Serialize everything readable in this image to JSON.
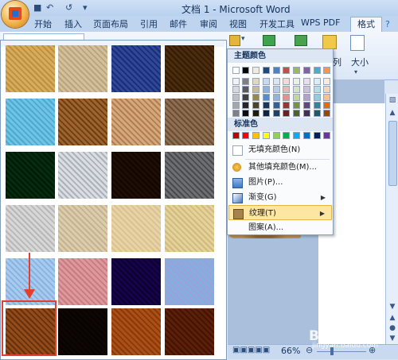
{
  "window": {
    "title": "文档 1 - Microsoft Word"
  },
  "tabs": [
    "开始",
    "插入",
    "页面布局",
    "引用",
    "邮件",
    "审阅",
    "视图",
    "开发工具",
    "WPS PDF",
    "格式"
  ],
  "ribbon": {
    "arrange_label": "列",
    "size_label": "大小"
  },
  "menu": {
    "theme_colors_label": "主题颜色",
    "standard_colors_label": "标准色",
    "items": [
      {
        "label": "无填充颜色(N)",
        "icon": "no-fill-icon"
      },
      {
        "label": "其他填充颜色(M)...",
        "icon": "palette-icon"
      },
      {
        "label": "图片(P)...",
        "icon": "picture-icon"
      },
      {
        "label": "渐变(G)",
        "icon": "gradient-icon",
        "submenu": true
      },
      {
        "label": "纹理(T)",
        "icon": "texture-icon",
        "submenu": true,
        "highlighted": true
      },
      {
        "label": "图案(A)...",
        "icon": "pattern-icon"
      }
    ],
    "theme_top_row": [
      "#ffffff",
      "#000000",
      "#eeece1",
      "#1f497d",
      "#4f81bd",
      "#c0504d",
      "#9bbb59",
      "#8064a2",
      "#4bacc6",
      "#f79646"
    ],
    "theme_shade_columns": [
      [
        "#f2f2f2",
        "#d9d9d9",
        "#bfbfbf",
        "#a6a6a6",
        "#808080"
      ],
      [
        "#7f7f7f",
        "#595959",
        "#404040",
        "#262626",
        "#0d0d0d"
      ],
      [
        "#ddd9c3",
        "#c4bd97",
        "#938953",
        "#494429",
        "#1d1b10"
      ],
      [
        "#c6d9f0",
        "#8db3e2",
        "#548dd4",
        "#17365d",
        "#0f243e"
      ],
      [
        "#dbe5f1",
        "#b8cce4",
        "#95b3d7",
        "#366092",
        "#244061"
      ],
      [
        "#f2dcdb",
        "#e5b9b7",
        "#d99694",
        "#953734",
        "#632423"
      ],
      [
        "#ebf1dd",
        "#d7e3bc",
        "#c3d69b",
        "#76923c",
        "#4f6128"
      ],
      [
        "#e5e0ec",
        "#ccc1d9",
        "#b2a2c7",
        "#5f497a",
        "#3f3151"
      ],
      [
        "#dbeef3",
        "#b7dde8",
        "#92cddc",
        "#31859b",
        "#205867"
      ],
      [
        "#fdeada",
        "#fbd5b5",
        "#fac08f",
        "#e36c09",
        "#974806"
      ]
    ],
    "standard_colors": [
      "#c00000",
      "#ff0000",
      "#ffc000",
      "#ffff00",
      "#92d050",
      "#00b050",
      "#00b0f0",
      "#0070c0",
      "#002060",
      "#7030a0"
    ]
  },
  "textures": {
    "selected_index": 20,
    "names": [
      "papyrus",
      "canvas",
      "denim",
      "woven-mat",
      "water-droplets",
      "paper-bag",
      "fish-fossil",
      "sand",
      "green-marble",
      "white-marble",
      "brown-marble",
      "granite",
      "newsprint",
      "recycled-paper",
      "parchment",
      "stationery",
      "blue-tissue-paper",
      "pink-tissue-paper",
      "purple-mesh",
      "bouquet",
      "cork",
      "walnut",
      "oak",
      "medium-wood"
    ],
    "colors": [
      [
        "#e9d29a",
        "#cfae68"
      ],
      [
        "#e8ddc7",
        "#cbbd9f"
      ],
      [
        "#6f88c4",
        "#3b55a0"
      ],
      [
        "#8a6a3a",
        "#5c4322"
      ],
      [
        "#a9dff0",
        "#6fc3e1"
      ],
      [
        "#c9a06a",
        "#8b6334"
      ],
      [
        "#e8cfb2",
        "#c49a72"
      ],
      [
        "#bfa88e",
        "#8c7662"
      ],
      [
        "#1f6a3a",
        "#0c3c1d"
      ],
      [
        "#eceef0",
        "#b9bec4"
      ],
      [
        "#5a3a22",
        "#2d1a0e"
      ],
      [
        "#a7a9ab",
        "#6e7073"
      ],
      [
        "#eaeaea",
        "#c8c8c8"
      ],
      [
        "#ece4d2",
        "#d5c8ad"
      ],
      [
        "#f3e8cf",
        "#e6d4ad"
      ],
      [
        "#f1e7c7",
        "#dccd9f"
      ],
      [
        "#cfe3f6",
        "#a7c8ea"
      ],
      [
        "#edc6c8",
        "#d99ea4"
      ],
      [
        "#4a1a8a",
        "#2a0a55"
      ],
      [
        "#b7d3ef",
        "#d9c2e8"
      ],
      [
        "#c18a50",
        "#8a5a2a"
      ],
      [
        "#3c2817",
        "#1f140b"
      ],
      [
        "#d08f4a",
        "#a9652a"
      ],
      [
        "#9a5a2a",
        "#6a3612"
      ]
    ]
  },
  "status": {
    "zoom": "66%"
  },
  "watermark": {
    "text": "Bai 经验",
    "url": "jingyan.baidu.com"
  }
}
